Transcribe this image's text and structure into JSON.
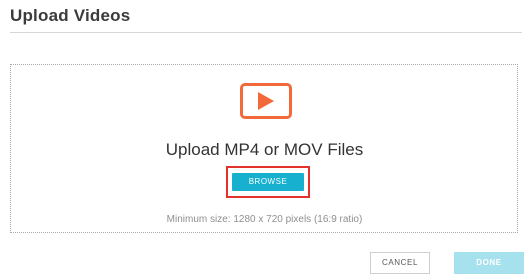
{
  "dialog": {
    "title": "Upload Videos"
  },
  "dropzone": {
    "icon": "video-play-icon",
    "heading": "Upload MP4 or MOV Files",
    "browse_label": "BROWSE",
    "hint": "Minimum size: 1280 x 720 pixels (16:9 ratio)"
  },
  "footer": {
    "cancel_label": "CANCEL",
    "done_label": "DONE"
  },
  "colors": {
    "accent": "#17b1cf",
    "icon": "#f26a3a",
    "highlight": "#e3312b",
    "done_disabled": "#a6e1ee"
  }
}
